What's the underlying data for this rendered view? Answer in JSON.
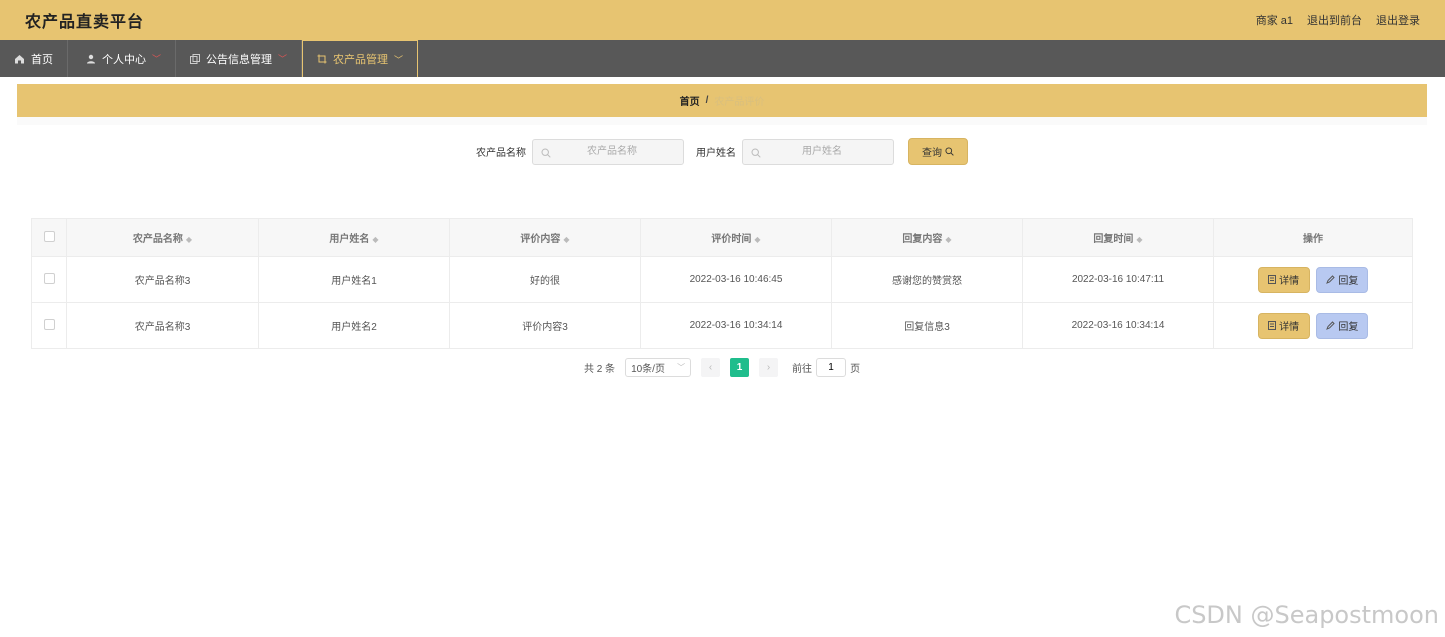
{
  "header": {
    "title": "农产品直卖平台",
    "user": "商家 a1",
    "to_front": "退出到前台",
    "logout": "退出登录"
  },
  "nav": [
    {
      "label": "首页",
      "icon": "home-icon"
    },
    {
      "label": "个人中心",
      "icon": "user-icon"
    },
    {
      "label": "公告信息管理",
      "icon": "copy-icon"
    },
    {
      "label": "农产品管理",
      "icon": "crop-icon",
      "active": true
    }
  ],
  "breadcrumb": {
    "home": "首页",
    "separator": "/",
    "current": "农产品评价"
  },
  "search": {
    "product_label": "农产品名称",
    "product_placeholder": "农产品名称",
    "user_label": "用户姓名",
    "user_placeholder": "用户姓名",
    "query_button": "查询"
  },
  "table": {
    "columns": [
      "农产品名称",
      "用户姓名",
      "评价内容",
      "评价时间",
      "回复内容",
      "回复时间",
      "操作"
    ],
    "rows": [
      {
        "product": "农产品名称3",
        "user": "用户姓名1",
        "content": "好的很",
        "time": "2022-03-16 10:46:45",
        "reply": "感谢您的赞赏怒",
        "reply_time": "2022-03-16 10:47:11"
      },
      {
        "product": "农产品名称3",
        "user": "用户姓名2",
        "content": "评价内容3",
        "time": "2022-03-16 10:34:14",
        "reply": "回复信息3",
        "reply_time": "2022-03-16 10:34:14"
      }
    ],
    "detail_button": "详情",
    "reply_button": "回复"
  },
  "pagination": {
    "total": "共 2 条",
    "page_size": "10条/页",
    "current_page": "1",
    "goto_label": "前往",
    "goto_value": "1",
    "page_unit": "页"
  },
  "watermark": "CSDN @Seapostmoon",
  "colors": {
    "accent": "#e7c471",
    "nav": "#585858",
    "pager_active": "#1fbd8c",
    "reply": "#b8c9f1"
  }
}
